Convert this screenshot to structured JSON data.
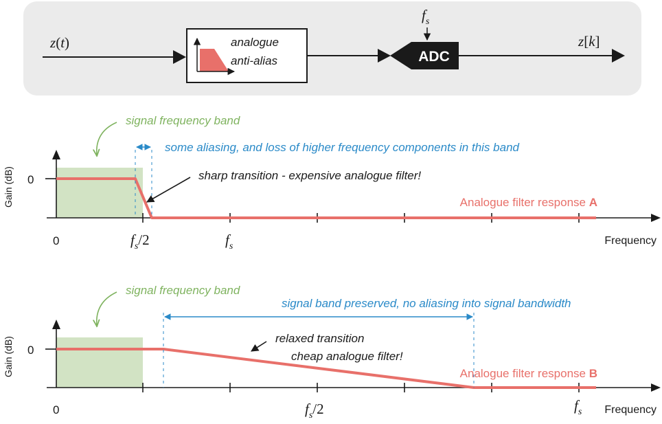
{
  "block_diagram": {
    "input_label": "z(t)",
    "input_var": "z",
    "input_arg": "t",
    "filter_label_line1": "analogue",
    "filter_label_line2": "anti-alias",
    "adc_label": "ADC",
    "sample_freq_main": "f",
    "sample_freq_sub": "s",
    "output_var": "z",
    "output_arg": "k"
  },
  "plot_a": {
    "ylabel": "Gain (dB)",
    "xlabel": "Frequency",
    "y_tick_zero": "0",
    "x_tick_zero": "0",
    "x_tick_half_main": "f",
    "x_tick_half_sub": "s",
    "x_tick_half_tail": "/2",
    "x_tick_fs_main": "f",
    "x_tick_fs_sub": "s",
    "band_label": "signal frequency band",
    "alias_note": "some aliasing, and loss of higher frequency components in this band",
    "transition_note": "sharp transition - expensive analogue filter!",
    "response_label": "Analogue filter response ",
    "response_letter": "A"
  },
  "plot_b": {
    "ylabel": "Gain (dB)",
    "xlabel": "Frequency",
    "y_tick_zero": "0",
    "x_tick_zero": "0",
    "x_tick_half_main": "f",
    "x_tick_half_sub": "s",
    "x_tick_half_tail": "/2",
    "x_tick_fs_main": "f",
    "x_tick_fs_sub": "s",
    "band_label": "signal frequency band",
    "preserved_note": "signal band preserved, no aliasing into signal bandwidth",
    "transition_note_line1": "relaxed transition",
    "transition_note_line2": "cheap analogue filter!",
    "response_label": "Analogue filter response ",
    "response_letter": "B"
  },
  "colors": {
    "response": "#e8706a",
    "band_fill": "#d2e3c4",
    "band_text": "#7fb35f",
    "note_blue": "#2a8ac8",
    "panel_bg": "#ebebeb",
    "ink": "#1a1a1a"
  }
}
